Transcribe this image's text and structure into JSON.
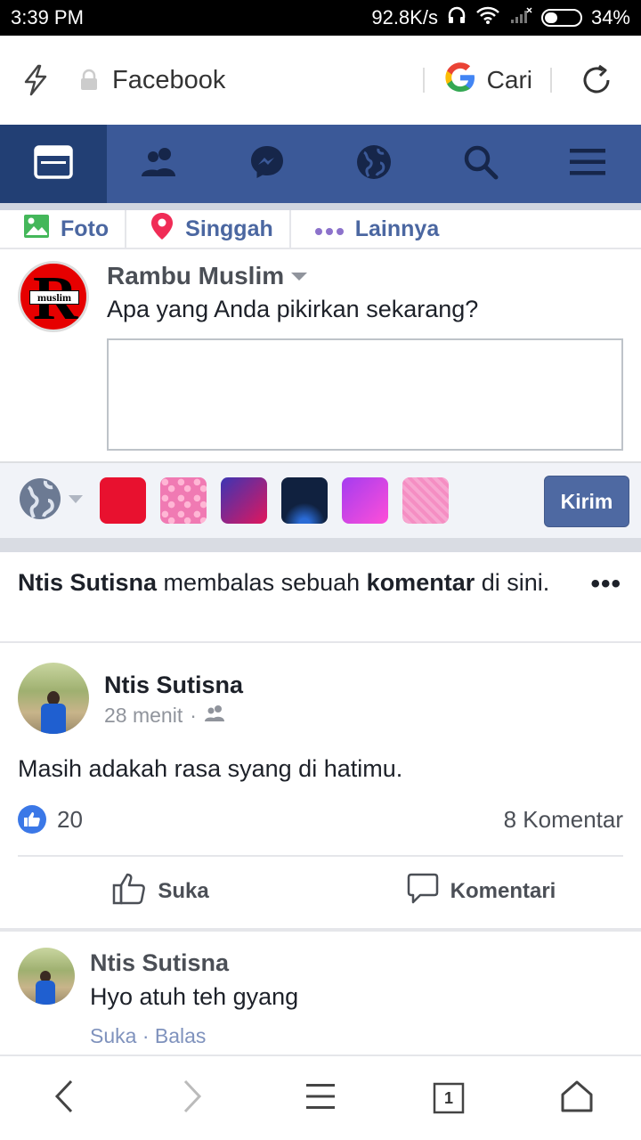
{
  "status_bar": {
    "time": "3:39 PM",
    "network_speed": "92.8K/s",
    "battery": "34%"
  },
  "browser": {
    "title": "Facebook",
    "search_label": "Cari"
  },
  "fb_nav": {
    "items": [
      "news-feed",
      "friends",
      "messenger",
      "notifications",
      "search",
      "menu"
    ],
    "active": "news-feed",
    "bg_color": "#3b5998"
  },
  "composer": {
    "actions": [
      {
        "label": "Foto",
        "icon": "photo-icon"
      },
      {
        "label": "Singgah",
        "icon": "location-pin-icon"
      },
      {
        "label": "Lainnya",
        "icon": "more-dots-icon"
      }
    ],
    "user_name": "Rambu Muslim",
    "prompt": "Apa yang Anda pikirkan sekarang?",
    "text_value": "",
    "avatar_text": "muslim",
    "submit_label": "Kirim"
  },
  "notification": {
    "actor": "Ntis Sutisna",
    "middle": " membalas sebuah ",
    "object": "komentar",
    "tail": " di sini.",
    "more": "•••"
  },
  "post": {
    "author": "Ntis Sutisna",
    "time": "28 menit",
    "separator": "·",
    "privacy": "friends",
    "text": "Masih adakah rasa syang di hatimu.",
    "like_count": "20",
    "comment_count": "8 Komentar",
    "like_label": "Suka",
    "comment_label": "Komentari"
  },
  "comment": {
    "author": "Ntis Sutisna",
    "text": "Hyo atuh teh gyang",
    "actions": "Suka · Balas"
  },
  "bottom_bar": {
    "tab_count": "1"
  }
}
